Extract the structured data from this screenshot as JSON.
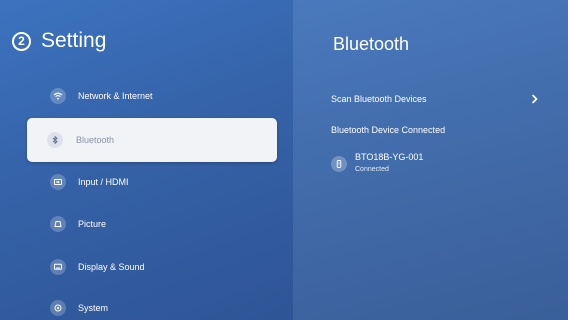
{
  "header": {
    "badge": "2",
    "title": "Setting"
  },
  "menu": {
    "items": [
      {
        "label": "Network & Internet",
        "icon": "wifi-icon"
      },
      {
        "label": "Bluetooth",
        "icon": "bluetooth-icon",
        "selected": true
      },
      {
        "label": "Input / HDMI",
        "icon": "input-icon"
      },
      {
        "label": "Picture",
        "icon": "picture-icon"
      },
      {
        "label": "Display & Sound",
        "icon": "display-icon"
      },
      {
        "label": "System",
        "icon": "system-icon"
      }
    ]
  },
  "bluetooth_panel": {
    "title": "Bluetooth",
    "scan_label": "Scan Bluetooth Devices",
    "connected_heading": "Bluetooth Device Connected",
    "device": {
      "name": "BTO18B-YG-001",
      "status": "Connected",
      "icon": "device-icon"
    }
  },
  "colors": {
    "left_panel": "#3562a8",
    "right_panel": "#416ba9",
    "selected_bg": "#f1f3f7",
    "selected_text": "#8a94a6",
    "text": "#ffffff"
  }
}
